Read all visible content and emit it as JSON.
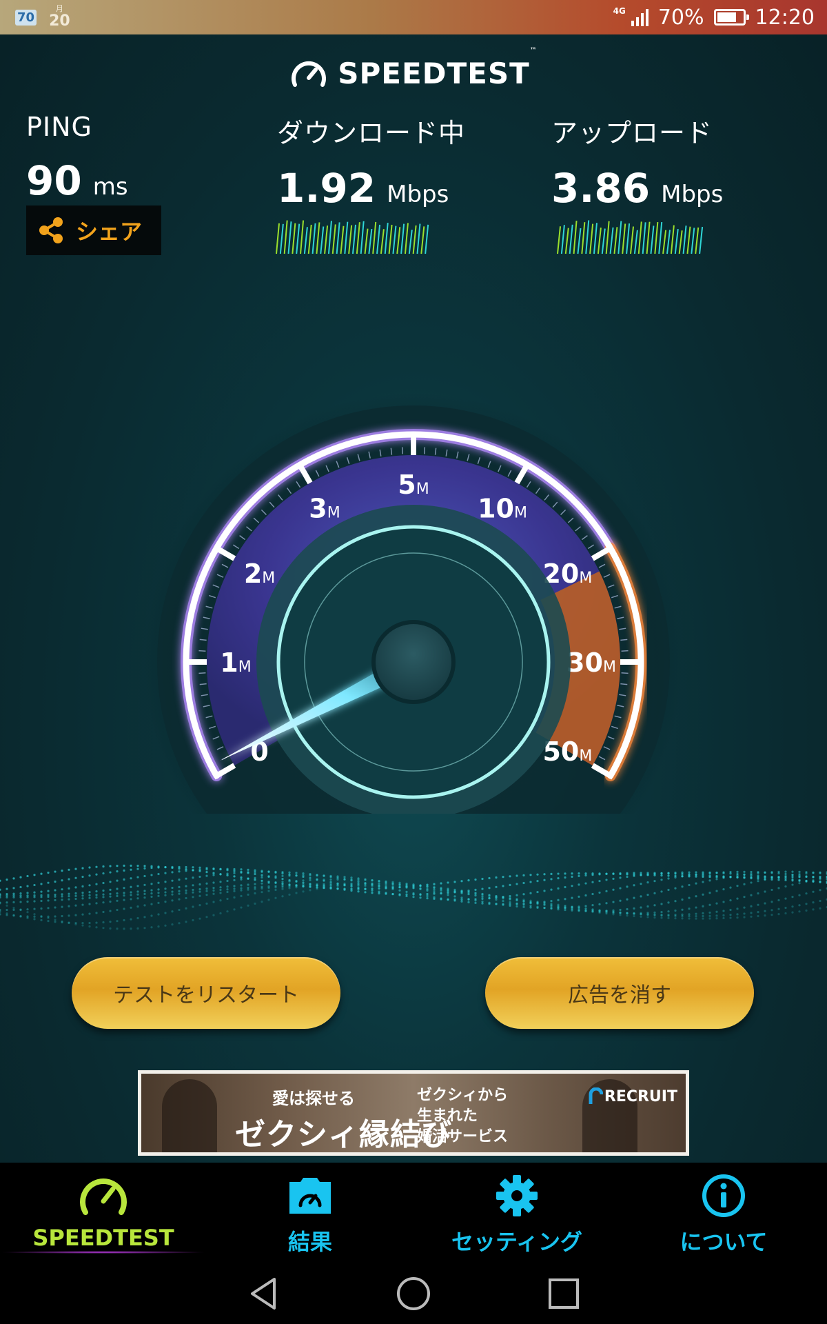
{
  "status_bar": {
    "badge": "70",
    "date_month": "月",
    "date_day": "20",
    "network": "4G",
    "battery": "70%",
    "time": "12:20"
  },
  "header": {
    "title": "SPEEDTEST",
    "trademark": "™"
  },
  "ping": {
    "label": "PING",
    "value": "90",
    "unit": "ms"
  },
  "download": {
    "label": "ダウンロード中",
    "value": "1.92",
    "unit": "Mbps"
  },
  "upload": {
    "label": "アップロード",
    "value": "3.86",
    "unit": "Mbps"
  },
  "share": {
    "label": "シェア",
    "icon": "share-icon"
  },
  "gauge": {
    "scale": [
      {
        "num": "0",
        "unit": ""
      },
      {
        "num": "1",
        "unit": "M"
      },
      {
        "num": "2",
        "unit": "M"
      },
      {
        "num": "3",
        "unit": "M"
      },
      {
        "num": "5",
        "unit": "M"
      },
      {
        "num": "10",
        "unit": "M"
      },
      {
        "num": "20",
        "unit": "M"
      },
      {
        "num": "30",
        "unit": "M"
      },
      {
        "num": "50",
        "unit": "M"
      }
    ],
    "needle_value_mbps": 0.1,
    "colors": {
      "low_band": "#4c37a8",
      "high_band": "#e07a2a",
      "needle": "#7fe8ff"
    }
  },
  "buttons": {
    "restart": "テストをリスタート",
    "remove_ads": "広告を消す"
  },
  "ad": {
    "line1": "愛は探せる",
    "line2": "ゼクシィ縁結び",
    "line3a": "ゼクシィから",
    "line3b": "生まれた",
    "line3c": "婚活サービス",
    "brand": "RECRUIT"
  },
  "nav": {
    "items": [
      {
        "label": "SPEEDTEST",
        "icon": "speedometer-icon"
      },
      {
        "label": "結果",
        "icon": "results-icon"
      },
      {
        "label": "セッティング",
        "icon": "gear-icon"
      },
      {
        "label": "について",
        "icon": "info-icon"
      }
    ]
  },
  "colors": {
    "accent_yellow": "#f2a31c",
    "nav_active": "#b8e63c",
    "nav_inactive": "#19c4f0"
  }
}
